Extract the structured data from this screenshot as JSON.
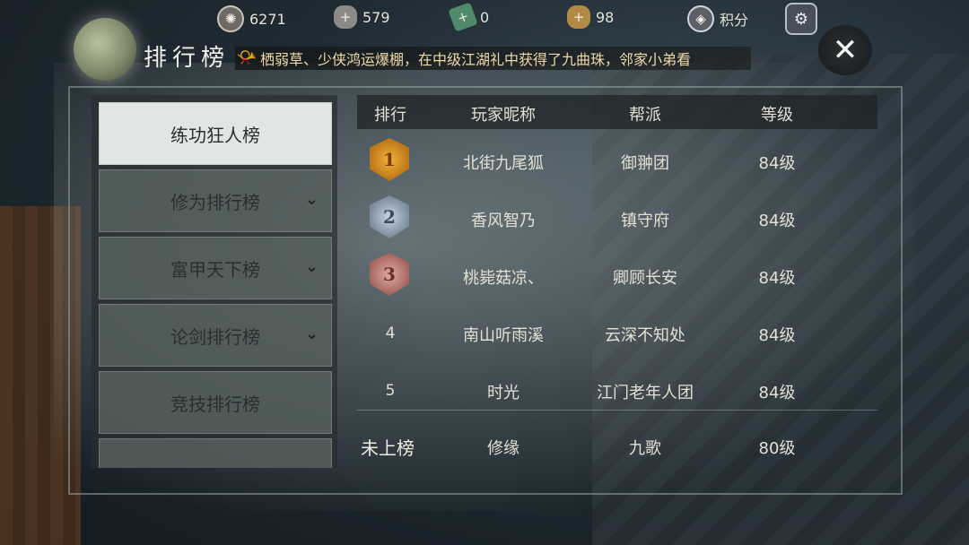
{
  "resources": {
    "coin": "6271",
    "ingot": "579",
    "ticket": "0",
    "gold": "98",
    "score_label": "积分"
  },
  "icons": {
    "coin": "film-coin-icon",
    "ingot": "silver-ingot-plus-icon",
    "ticket": "ticket-plus-icon",
    "gold": "gold-ingot-plus-icon",
    "score": "shield-score-icon",
    "settings": "gear-icon",
    "horn": "horn-icon",
    "close": "close-icon",
    "chevron": "chevron-down-icon"
  },
  "panel": {
    "title": "排行榜",
    "ticker": "栖弱草、少侠鸿运爆棚，在中级江湖礼中获得了九曲珠，邻家小弟看"
  },
  "sidebar": {
    "items": [
      {
        "label": "练功狂人榜",
        "active": true,
        "has_chevron": false
      },
      {
        "label": "修为排行榜",
        "active": false,
        "has_chevron": true
      },
      {
        "label": "富甲天下榜",
        "active": false,
        "has_chevron": true
      },
      {
        "label": "论剑排行榜",
        "active": false,
        "has_chevron": true
      },
      {
        "label": "竞技排行榜",
        "active": false,
        "has_chevron": false
      },
      {
        "label": "",
        "active": false,
        "has_chevron": false
      }
    ]
  },
  "table": {
    "headers": [
      "排行",
      "玩家昵称",
      "帮派",
      "等级"
    ],
    "rows": [
      {
        "rank": "1",
        "name": "北街九尾狐",
        "guild": "御翀团",
        "level": "84级",
        "medal": "gold"
      },
      {
        "rank": "2",
        "name": "香风智乃",
        "guild": "镇守府",
        "level": "84级",
        "medal": "silver"
      },
      {
        "rank": "3",
        "name": "桃毙菇凉、",
        "guild": "卿顾长安",
        "level": "84级",
        "medal": "bronze"
      },
      {
        "rank": "4",
        "name": "南山听雨溪",
        "guild": "云深不知处",
        "level": "84级",
        "medal": ""
      },
      {
        "rank": "5",
        "name": "时光",
        "guild": "江门老年人团",
        "level": "84级",
        "medal": ""
      }
    ],
    "self": {
      "rank": "未上榜",
      "name": "修缘",
      "guild": "九歌",
      "level": "80级"
    }
  }
}
